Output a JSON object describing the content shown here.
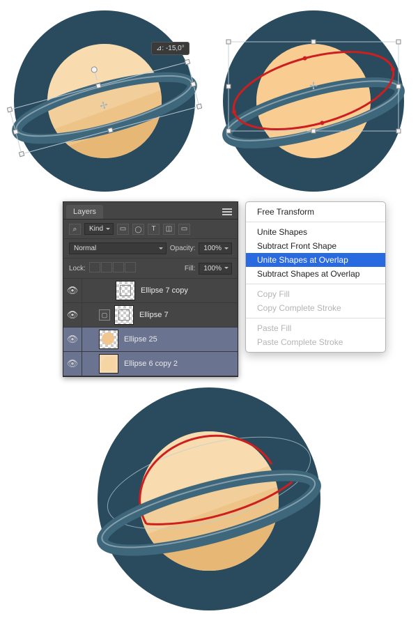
{
  "angle_badge": "⊿: -15,0°",
  "layers_panel": {
    "title": "Layers",
    "filter_label": "Kind",
    "blend_mode": "Normal",
    "opacity_label": "Opacity:",
    "opacity_value": "100%",
    "lock_label": "Lock:",
    "fill_label": "Fill:",
    "fill_value": "100%",
    "layers": [
      {
        "name": "Ellipse 7 copy",
        "selected": false,
        "indent": 2,
        "thumb": "checker"
      },
      {
        "name": "Ellipse 7",
        "selected": false,
        "indent": 1,
        "thumb": "vect"
      },
      {
        "name": "Ellipse 25",
        "selected": true,
        "indent": 1,
        "thumb": "orange"
      },
      {
        "name": "Ellipse 6 copy 2",
        "selected": true,
        "indent": 1,
        "thumb": "tan"
      }
    ]
  },
  "context_menu": {
    "items": [
      {
        "label": "Free Transform",
        "type": "item"
      },
      {
        "label": "",
        "type": "sep"
      },
      {
        "label": "Unite Shapes",
        "type": "item"
      },
      {
        "label": "Subtract Front Shape",
        "type": "item"
      },
      {
        "label": "Unite Shapes at Overlap",
        "type": "selected"
      },
      {
        "label": "Subtract Shapes at Overlap",
        "type": "item"
      },
      {
        "label": "",
        "type": "sep"
      },
      {
        "label": "Copy Fill",
        "type": "disabled"
      },
      {
        "label": "Copy Complete Stroke",
        "type": "disabled"
      },
      {
        "label": "",
        "type": "sep"
      },
      {
        "label": "Paste Fill",
        "type": "disabled"
      },
      {
        "label": "Paste Complete Stroke",
        "type": "disabled"
      }
    ]
  },
  "chart_data": {
    "type": "table",
    "title": "Saturn icon tutorial – Unite Shapes at Overlap step",
    "planets": {
      "background": "#2a4b5d",
      "body_colors": [
        "#f8dcb0",
        "#f2cf9a",
        "#edc388",
        "#e7b776"
      ],
      "ring_color": "#3e677b",
      "ring_highlight": "#c9d6dc"
    }
  }
}
